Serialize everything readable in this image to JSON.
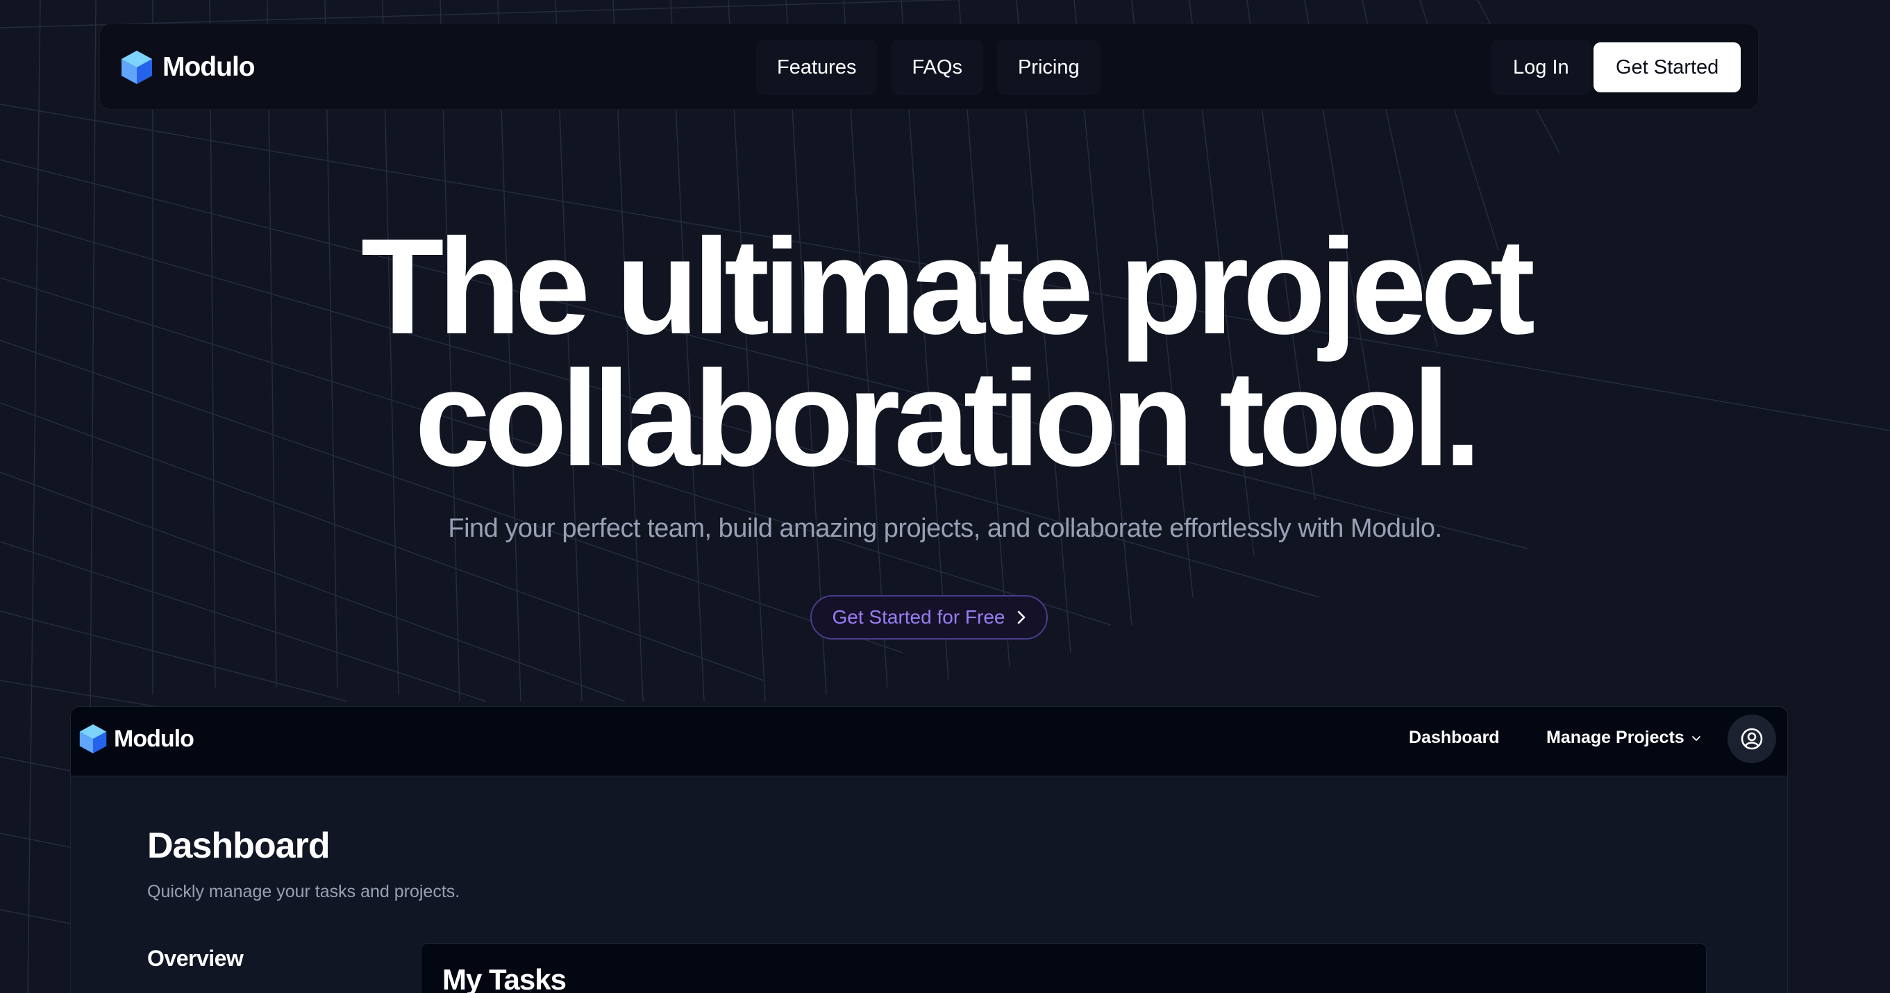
{
  "brand": {
    "name": "Modulo",
    "logo_icon": "cube-logo-icon",
    "accent": "#3b82f6"
  },
  "nav": {
    "links": [
      {
        "label": "Features"
      },
      {
        "label": "FAQs"
      },
      {
        "label": "Pricing"
      }
    ],
    "login_label": "Log In",
    "get_started_label": "Get Started"
  },
  "hero": {
    "title_line1": "The ultimate project",
    "title_line2": "collaboration tool.",
    "subtitle": "Find your perfect team, build amazing projects, and collaborate effortlessly with Modulo.",
    "cta_label": "Get Started for Free",
    "cta_icon": "chevron-right-icon",
    "cta_color": "#9b7df2"
  },
  "preview": {
    "brand_name": "Modulo",
    "nav_dashboard": "Dashboard",
    "nav_manage": "Manage Projects",
    "manage_icon": "chevron-down-icon",
    "avatar_icon": "user-circle-icon",
    "page_title": "Dashboard",
    "page_subtitle": "Quickly manage your tasks and projects.",
    "overview_heading": "Overview",
    "tasks_heading": "My Tasks"
  }
}
